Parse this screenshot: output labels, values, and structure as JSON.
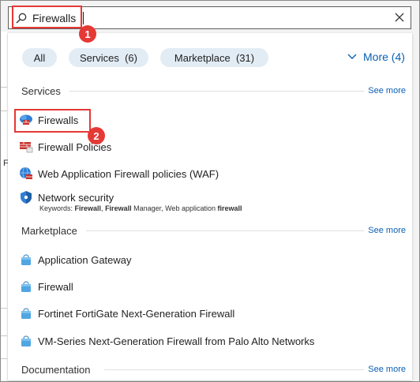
{
  "search": {
    "value": "Firewalls",
    "placeholder": ""
  },
  "filters": [
    {
      "label": "All"
    },
    {
      "label": "Services  (6)"
    },
    {
      "label": "Marketplace  (31)"
    }
  ],
  "more_label": "More (4)",
  "sections": {
    "services": {
      "title": "Services",
      "see_more": "See more",
      "items": [
        {
          "label": "Firewalls",
          "icon": "firewall-icon"
        },
        {
          "label": "Firewall Policies",
          "icon": "firewall-policy-icon"
        },
        {
          "label": "Web Application Firewall policies (WAF)",
          "icon": "waf-globe-icon"
        },
        {
          "label": "Network security",
          "icon": "shield-icon"
        }
      ],
      "keywords": {
        "prefix": "Keywords: ",
        "k1": "Firewall",
        "sep1": ", ",
        "k2": "Firewall",
        "mid": " Manager, Web application ",
        "k3": "firewall"
      }
    },
    "marketplace": {
      "title": "Marketplace",
      "see_more": "See more",
      "items": [
        {
          "label": "Application Gateway",
          "icon": "marketplace-bag-icon"
        },
        {
          "label": "Firewall",
          "icon": "marketplace-bag-icon"
        },
        {
          "label": "Fortinet FortiGate Next-Generation Firewall",
          "icon": "marketplace-bag-icon"
        },
        {
          "label": "VM-Series Next-Generation Firewall from Palo Alto Networks",
          "icon": "marketplace-bag-icon"
        }
      ]
    },
    "documentation": {
      "title": "Documentation",
      "see_more": "See more"
    }
  },
  "callouts": [
    "1",
    "2"
  ],
  "background": {
    "partial_char": "F"
  },
  "colors": {
    "accent": "#0a5fb4",
    "callout": "#e53935",
    "pill": "#e2ecf5"
  }
}
